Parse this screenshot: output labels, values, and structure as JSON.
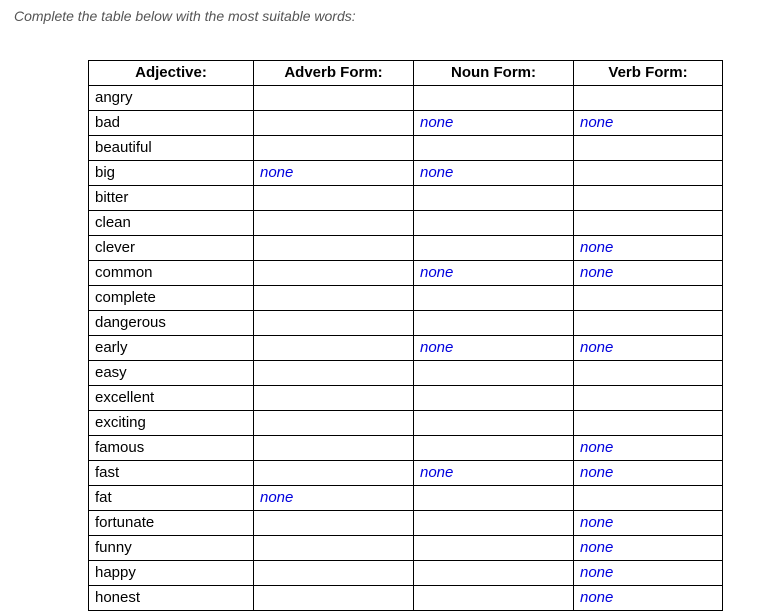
{
  "instruction": "Complete the table below with the most suitable words:",
  "none_label": "none",
  "headers": {
    "adjective": "Adjective:",
    "adverb": "Adverb Form:",
    "noun": "Noun Form:",
    "verb": "Verb Form:"
  },
  "chart_data": {
    "type": "table",
    "title": "Adjective / Adverb / Noun / Verb forms worksheet",
    "columns": [
      "Adjective:",
      "Adverb Form:",
      "Noun Form:",
      "Verb Form:"
    ],
    "rows": [
      {
        "adjective": "angry",
        "adverb": "",
        "noun": "",
        "verb": ""
      },
      {
        "adjective": "bad",
        "adverb": "",
        "noun": "none",
        "verb": "none"
      },
      {
        "adjective": "beautiful",
        "adverb": "",
        "noun": "",
        "verb": ""
      },
      {
        "adjective": "big",
        "adverb": "none",
        "noun": "none",
        "verb": ""
      },
      {
        "adjective": "bitter",
        "adverb": "",
        "noun": "",
        "verb": ""
      },
      {
        "adjective": "clean",
        "adverb": "",
        "noun": "",
        "verb": ""
      },
      {
        "adjective": "clever",
        "adverb": "",
        "noun": "",
        "verb": "none"
      },
      {
        "adjective": "common",
        "adverb": "",
        "noun": "none",
        "verb": "none"
      },
      {
        "adjective": "complete",
        "adverb": "",
        "noun": "",
        "verb": ""
      },
      {
        "adjective": "dangerous",
        "adverb": "",
        "noun": "",
        "verb": ""
      },
      {
        "adjective": "early",
        "adverb": "",
        "noun": "none",
        "verb": "none"
      },
      {
        "adjective": "easy",
        "adverb": "",
        "noun": "",
        "verb": ""
      },
      {
        "adjective": "excellent",
        "adverb": "",
        "noun": "",
        "verb": ""
      },
      {
        "adjective": "exciting",
        "adverb": "",
        "noun": "",
        "verb": ""
      },
      {
        "adjective": "famous",
        "adverb": "",
        "noun": "",
        "verb": "none"
      },
      {
        "adjective": "fast",
        "adverb": "",
        "noun": "none",
        "verb": "none"
      },
      {
        "adjective": "fat",
        "adverb": "none",
        "noun": "",
        "verb": ""
      },
      {
        "adjective": "fortunate",
        "adverb": "",
        "noun": "",
        "verb": "none"
      },
      {
        "adjective": "funny",
        "adverb": "",
        "noun": "",
        "verb": "none"
      },
      {
        "adjective": "happy",
        "adverb": "",
        "noun": "",
        "verb": "none"
      },
      {
        "adjective": "honest",
        "adverb": "",
        "noun": "",
        "verb": "none"
      }
    ]
  }
}
